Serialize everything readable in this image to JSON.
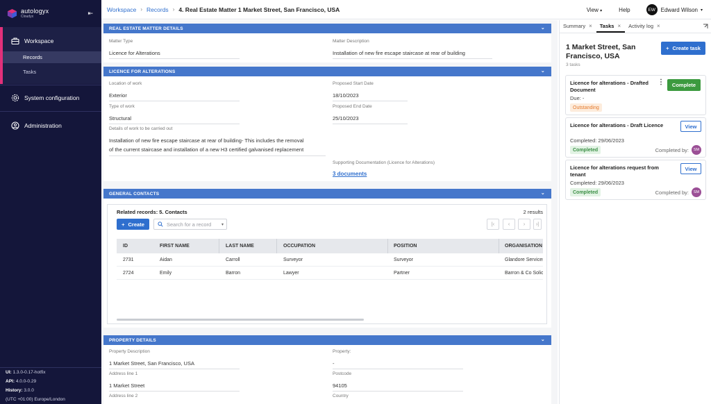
{
  "sidebar": {
    "logo_name": "autologyx",
    "logo_sub": "Cloudyx",
    "workspace": "Workspace",
    "records": "Records",
    "tasks": "Tasks",
    "system_config": "System configuration",
    "administration": "Administration",
    "version": {
      "ui_label": "UI:",
      "ui_value": "1.3.0-0.17-hotfix",
      "api_label": "API:",
      "api_value": "4.0.0-0.29",
      "history_label": "History:",
      "history_value": "3.0.0",
      "timezone": "(UTC +01:00) Europe/London"
    },
    "accent_color": "#e2307a"
  },
  "topbar": {
    "crumb1": "Workspace",
    "crumb2": "Records",
    "crumb3": "4. Real Estate Matter 1 Market Street, San Francisco, USA",
    "view": "View",
    "help": "Help",
    "avatar": "EW",
    "user": "Edward Wilson"
  },
  "real_estate": {
    "header": "REAL ESTATE MATTER DETAILS",
    "matter_type_label": "Matter Type",
    "matter_type": "Licence for Alterations",
    "matter_desc_label": "Matter Description",
    "matter_desc": "Installation of new fire escape staircase at rear of building"
  },
  "licence": {
    "header": "LICENCE FOR ALTERATIONS",
    "location_label": "Location of work",
    "location": "Exterior",
    "start_label": "Proposed Start Date",
    "start": "18/10/2023",
    "type_label": "Type of work",
    "type": "Structural",
    "end_label": "Proposed End Date",
    "end": "25/10/2023",
    "details_label": "Details of work to be carried out",
    "details_line1": "Installation of new fire escape staircase at rear of building- This includes the removal",
    "details_line2": "of the current staircase and installation of a new H3 certified galvanised replacement",
    "docs_label": "Supporting Documentation (Licence for Alterations)",
    "docs_link": "3 documents"
  },
  "contacts": {
    "header": "GENERAL CONTACTS",
    "related": "Related records: 5. Contacts",
    "results": "2 results",
    "create": "Create",
    "search_placeholder": "Search for a record",
    "columns": [
      "ID",
      "FIRST NAME",
      "LAST NAME",
      "OCCUPATION",
      "POSITION",
      "ORGANISATION"
    ],
    "rows": [
      [
        "2731",
        "Aidan",
        "Carroll",
        "Surveyor",
        "Surveyor",
        "Glandore Services"
      ],
      [
        "2724",
        "Emily",
        "Barron",
        "Lawyer",
        "Partner",
        "Barron & Co Solic"
      ]
    ]
  },
  "property": {
    "header": "PROPERTY DETAILS",
    "desc_label": "Property Description",
    "desc": "1 Market Street, San Francisco, USA",
    "property_label": "Property:",
    "property": "-",
    "addr1_label": "Address line 1",
    "addr1": "1 Market Street",
    "postcode_label": "Postcode",
    "postcode": "94105",
    "addr2_label": "Address line 2",
    "country_label": "Country"
  },
  "right_panel": {
    "tab_summary": "Summary",
    "tab_tasks": "Tasks",
    "tab_activity": "Activity log",
    "title": "1 Market Street, San Francisco, USA",
    "count": "3 tasks",
    "create_task": "Create task",
    "tasks": [
      {
        "title": "Licence for alterations - Drafted Document",
        "due": "Due: -",
        "status": "Outstanding",
        "action": "Complete"
      },
      {
        "title": "Licence for alterations - Draft Licence",
        "due": "Completed: 29/06/2023",
        "status": "Completed",
        "action": "View",
        "completed_by": "Completed by:",
        "avatar": "SM"
      },
      {
        "title": "Licence for alterations request from tenant",
        "due": "Completed: 29/06/2023",
        "status": "Completed",
        "action": "View",
        "completed_by": "Completed by:",
        "avatar": "SM"
      }
    ]
  }
}
